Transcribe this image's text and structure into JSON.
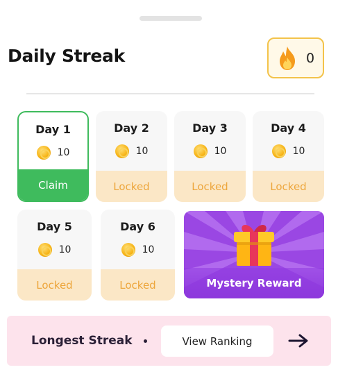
{
  "header": {
    "title": "Daily Streak",
    "streak_count": "0",
    "streak_icon": "flame-icon"
  },
  "days": [
    {
      "label": "Day 1",
      "reward": "10",
      "status": "Claim",
      "state": "claimable"
    },
    {
      "label": "Day 2",
      "reward": "10",
      "status": "Locked",
      "state": "locked"
    },
    {
      "label": "Day 3",
      "reward": "10",
      "status": "Locked",
      "state": "locked"
    },
    {
      "label": "Day 4",
      "reward": "10",
      "status": "Locked",
      "state": "locked"
    },
    {
      "label": "Day 5",
      "reward": "10",
      "status": "Locked",
      "state": "locked"
    },
    {
      "label": "Day 6",
      "reward": "10",
      "status": "Locked",
      "state": "locked"
    }
  ],
  "mystery": {
    "label": "Mystery Reward",
    "icon": "gift-icon"
  },
  "footer": {
    "streak_label": "Longest Streak",
    "ranking_button": "View Ranking",
    "arrow_icon": "arrow-right-icon"
  },
  "colors": {
    "claim_green": "#3fbb5d",
    "locked_bg": "#fbe7c6",
    "locked_text": "#eda63c",
    "mystery_purple": "#a34fe8",
    "badge_border": "#f3c34a",
    "footer_pink": "#fde3ec"
  }
}
